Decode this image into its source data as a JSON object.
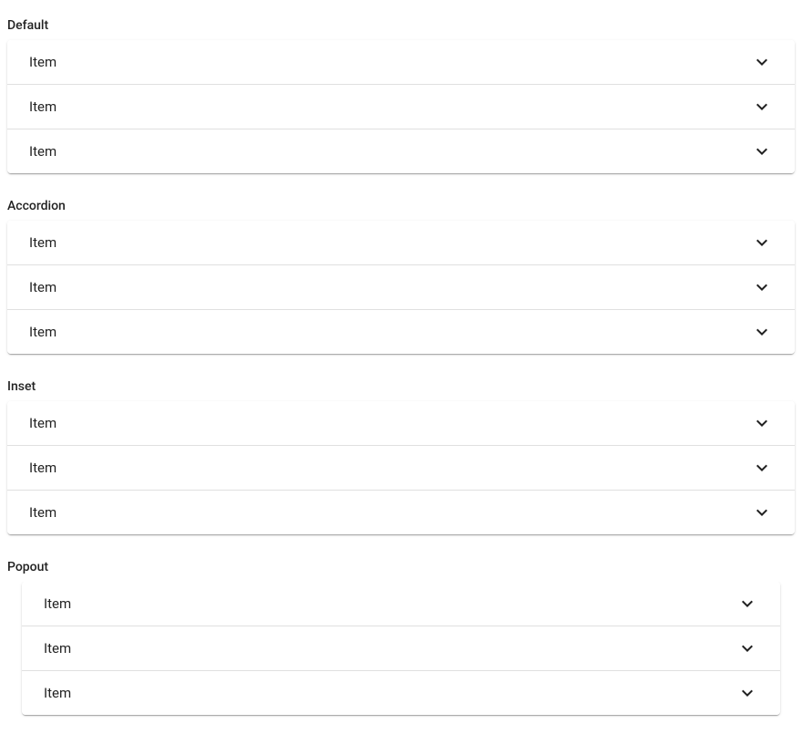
{
  "sections": [
    {
      "label": "Default",
      "variant": "default",
      "items": [
        {
          "label": "Item"
        },
        {
          "label": "Item"
        },
        {
          "label": "Item"
        }
      ]
    },
    {
      "label": "Accordion",
      "variant": "accordion",
      "items": [
        {
          "label": "Item"
        },
        {
          "label": "Item"
        },
        {
          "label": "Item"
        }
      ]
    },
    {
      "label": "Inset",
      "variant": "inset",
      "items": [
        {
          "label": "Item"
        },
        {
          "label": "Item"
        },
        {
          "label": "Item"
        }
      ]
    },
    {
      "label": "Popout",
      "variant": "popout",
      "items": [
        {
          "label": "Item"
        },
        {
          "label": "Item"
        },
        {
          "label": "Item"
        }
      ]
    }
  ]
}
